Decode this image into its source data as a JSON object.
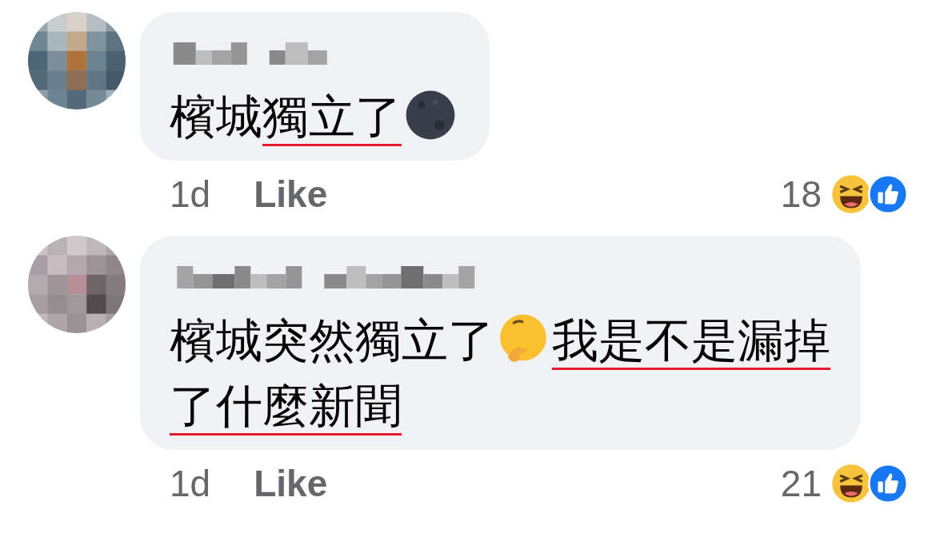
{
  "comments": [
    {
      "avatar": {
        "kind": "picture"
      },
      "author": {
        "kind": "picture"
      },
      "lines": [
        [
          {
            "kind": "text",
            "text": "檳城",
            "underlined": false
          },
          {
            "kind": "text",
            "text": "獨立了",
            "underlined": true
          },
          {
            "kind": "moon-face"
          }
        ]
      ],
      "time": "1d",
      "like": "Like",
      "reaction_count": "18"
    },
    {
      "avatar": {
        "kind": "picture"
      },
      "author": {
        "kind": "picture"
      },
      "lines": [
        [
          {
            "kind": "text",
            "text": "檳城突然獨立了",
            "underlined": false
          },
          {
            "kind": "thinking-face"
          },
          {
            "kind": "text",
            "text": "我是不是漏掉",
            "underlined": true
          }
        ],
        [
          {
            "kind": "text",
            "text": "了什麼新聞",
            "underlined": true
          }
        ]
      ],
      "time": "1d",
      "like": "Like",
      "reaction_count": "21"
    }
  ]
}
